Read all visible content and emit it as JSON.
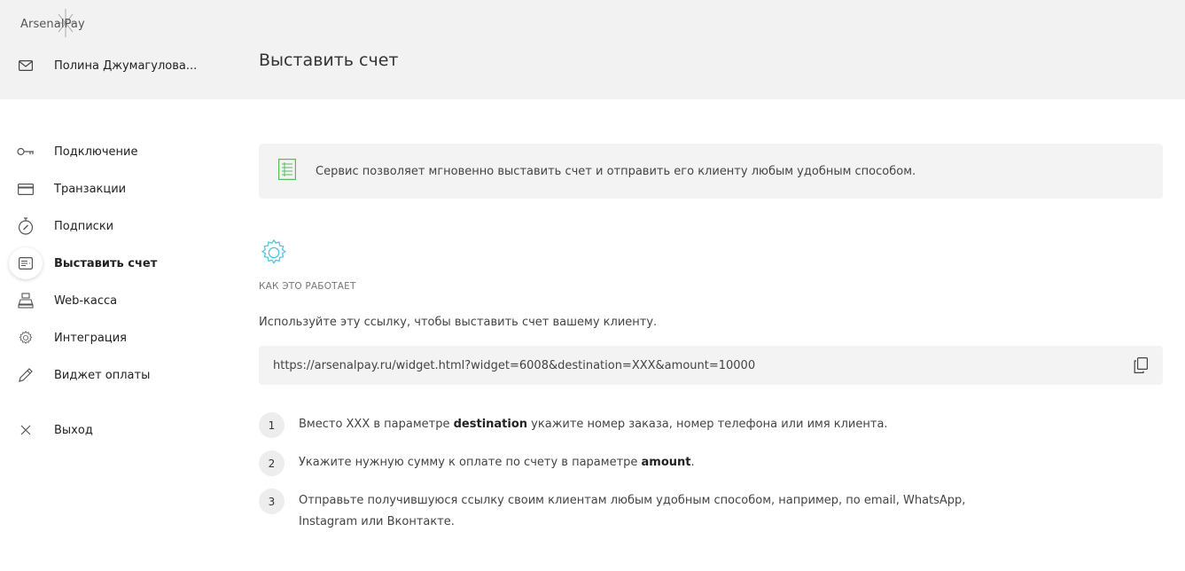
{
  "app": {
    "logo_text": "ArsenalPay"
  },
  "user": {
    "name": "Полина Джумагулова..."
  },
  "page": {
    "title": "Выставить счет"
  },
  "sidebar": {
    "items": [
      {
        "label": "Подключение",
        "icon": "key-icon"
      },
      {
        "label": "Транзакции",
        "icon": "card-icon"
      },
      {
        "label": "Подписки",
        "icon": "stopwatch-icon"
      },
      {
        "label": "Выставить счет",
        "icon": "invoice-icon",
        "active": true
      },
      {
        "label": "Web-касса",
        "icon": "cash-register-icon"
      },
      {
        "label": "Интеграция",
        "icon": "gear-icon"
      },
      {
        "label": "Виджет оплаты",
        "icon": "pencil-icon"
      },
      {
        "label": "Выход",
        "icon": "close-icon"
      }
    ]
  },
  "info": {
    "text": "Сервис позволяет мгновенно выставить счет и отправить его клиенту любым удобным способом."
  },
  "how": {
    "caption": "КАК ЭТО РАБОТАЕТ",
    "intro": "Используйте эту ссылку, чтобы выставить счет вашему клиенту.",
    "link": "https://arsenalpay.ru/widget.html?widget=6008&destination=XXX&amount=10000"
  },
  "steps": [
    {
      "num": "1",
      "before": "Вместо XXX в параметре ",
      "bold": "destination",
      "after": " укажите номер заказа, номер телефона или имя клиента."
    },
    {
      "num": "2",
      "before": "Укажите нужную сумму к оплате по счету в параметре ",
      "bold": "amount",
      "after": "."
    },
    {
      "num": "3",
      "before": "Отправьте получившуюся ссылку своим клиентам любым удобным способом, например, по email, WhatsApp, Instagram или Вконтакте.",
      "bold": "",
      "after": ""
    }
  ],
  "colors": {
    "accent": "#4ec3e0",
    "green": "#5cb85c",
    "header_bg": "#f2f2f2"
  }
}
